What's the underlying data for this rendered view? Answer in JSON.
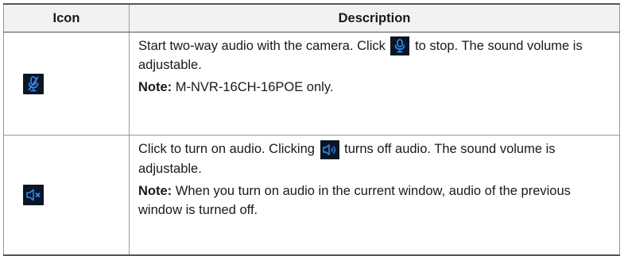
{
  "table": {
    "headers": {
      "icon": "Icon",
      "description": "Description"
    },
    "rows": [
      {
        "icon": "mic-muted-icon",
        "desc_before": "Start two-way audio with the camera. Click",
        "inline_icon": "mic-icon",
        "desc_after": "to stop. The sound volume is adjustable.",
        "note_label": "Note:",
        "note_text": "M-NVR-16CH-16POE only."
      },
      {
        "icon": "speaker-muted-icon",
        "desc_before": "Click to turn on audio. Clicking",
        "inline_icon": "speaker-on-icon",
        "desc_after": "turns off audio. The sound volume is adjustable.",
        "note_label": "Note:",
        "note_text": "When you turn on audio in the current window, audio of the previous window is turned off."
      }
    ]
  },
  "colors": {
    "icon_bg": "#0c1525",
    "icon_fg": "#2f8fff",
    "header_bg": "#f2f2f2"
  }
}
